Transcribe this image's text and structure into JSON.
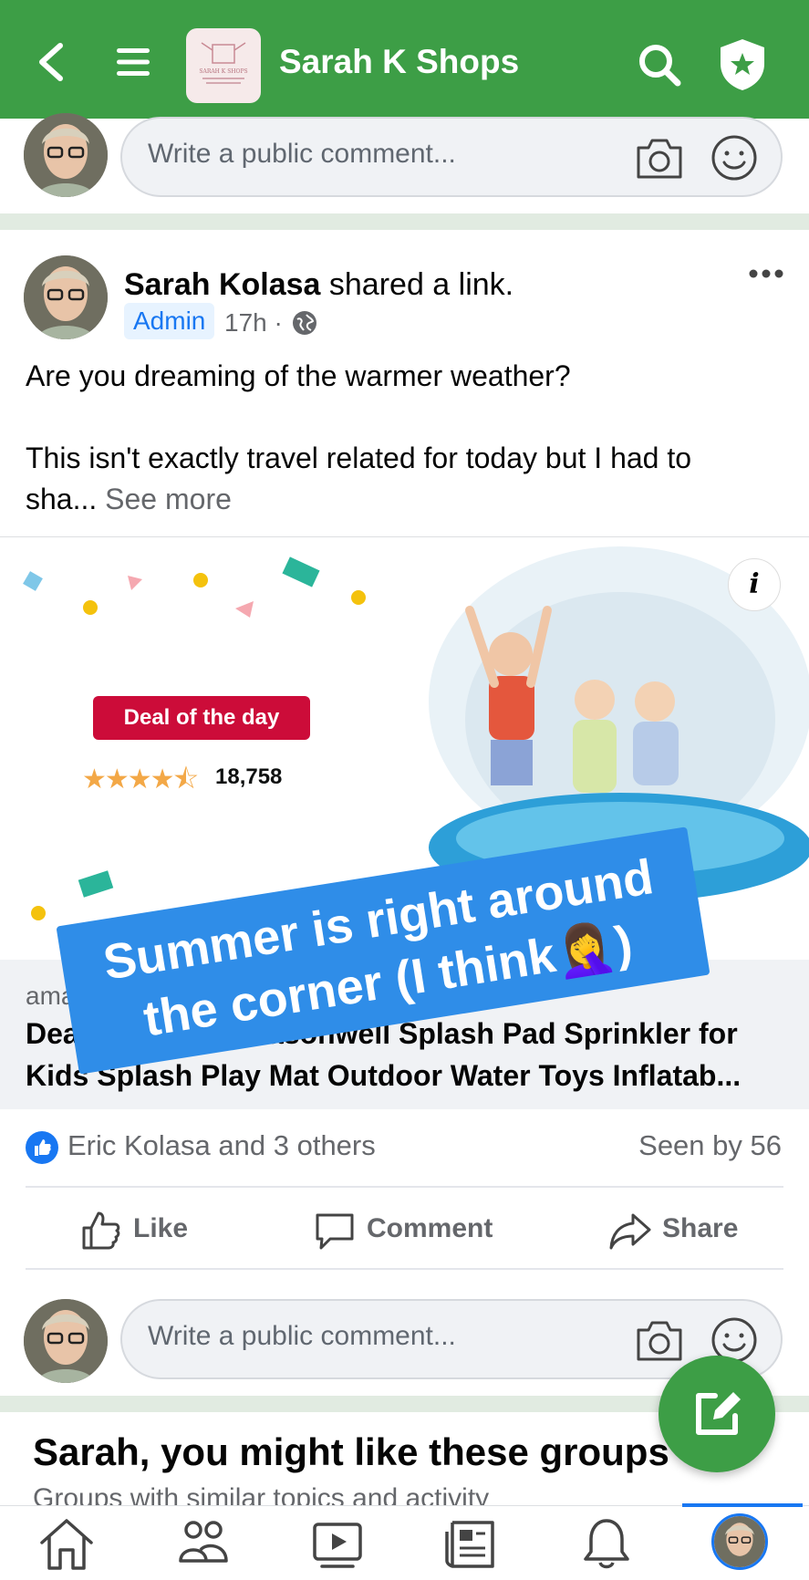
{
  "header": {
    "group_name": "Sarah K Shops",
    "logo_text": "SARAH K SHOPS"
  },
  "comment_box_top": {
    "placeholder": "Write a public comment..."
  },
  "post": {
    "author": "Sarah Kolasa",
    "action_text": " shared a link.",
    "role_badge": "Admin",
    "time": "17h ·",
    "line1": "Are you dreaming of the warmer weather?",
    "line2": "This isn't exactly travel related for today but I had to",
    "line3_prefix": "sha... ",
    "see_more": "See more",
    "link": {
      "deal_badge": "Deal of the day",
      "stars": "★★★★⯪",
      "review_count": "18,758",
      "overlay_caption_line1": "Summer is right around",
      "overlay_caption_line2": "the corner (I think🤦‍♀️)",
      "domain": "amazon",
      "title": "Deal of the day: Jasonwell Splash Pad Sprinkler for Kids Splash Play Mat Outdoor Water Toys Inflatab..."
    },
    "reactions_text": "Eric Kolasa and 3 others",
    "seen_text": "Seen by 56",
    "actions": {
      "like": "Like",
      "comment": "Comment",
      "share": "Share"
    }
  },
  "comment_box_bottom": {
    "placeholder": "Write a public comment..."
  },
  "suggestions": {
    "title": "Sarah, you might like these groups",
    "subtitle": "Groups with similar topics and activity"
  },
  "colors": {
    "brand_green": "#3d9e46",
    "fb_blue": "#1877f2",
    "caption_blue": "#2f8de8",
    "amazon_red": "#cc0c39"
  },
  "icons": [
    "back-icon",
    "menu-icon",
    "search-icon",
    "shield-star-icon",
    "camera-icon",
    "emoji-icon",
    "globe-icon",
    "more-icon",
    "like-icon",
    "comment-icon",
    "share-icon",
    "compose-icon",
    "home-icon",
    "groups-icon",
    "video-icon",
    "news-icon",
    "bell-icon"
  ]
}
